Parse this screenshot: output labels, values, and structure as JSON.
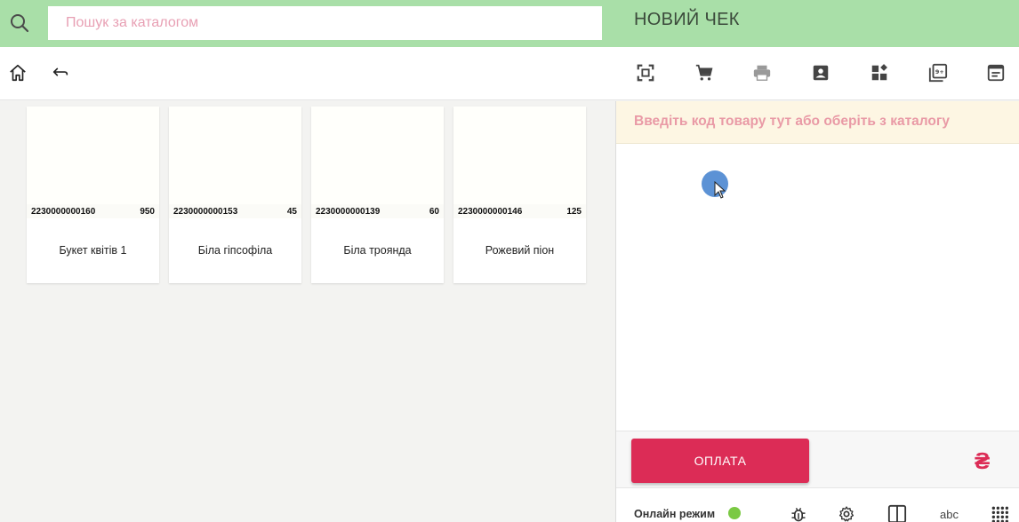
{
  "search": {
    "placeholder": "Пошук за каталогом",
    "value": ""
  },
  "receipt": {
    "title": "НОВИЙ ЧЕК"
  },
  "toolbar": {
    "left_icons": [
      "home-icon",
      "back-arrow-icon"
    ],
    "right_icons": [
      "scan-icon",
      "cart-icon",
      "print-icon",
      "contact-card-icon",
      "widgets-icon",
      "library-plus-icon",
      "receipt-view-icon"
    ]
  },
  "catalog": {
    "items": [
      {
        "barcode": "2230000000160",
        "price": "950",
        "name": "Букет квітів 1"
      },
      {
        "barcode": "2230000000153",
        "price": "45",
        "name": "Біла гіпсофіла"
      },
      {
        "barcode": "2230000000139",
        "price": "60",
        "name": "Біла троянда"
      },
      {
        "barcode": "2230000000146",
        "price": "125",
        "name": "Рожевий піон"
      }
    ]
  },
  "pane": {
    "hint": "Введіть код товару тут або оберіть з каталогу",
    "pay_label": "ОПЛАТА",
    "currency_symbol": "₴"
  },
  "status": {
    "online_label": "Онлайн режим",
    "abc_label": "abc"
  },
  "colors": {
    "topbar": "#a9dfa8",
    "accent": "#dc2c56",
    "online": "#7ac943",
    "hint_text": "#e99aa6"
  }
}
